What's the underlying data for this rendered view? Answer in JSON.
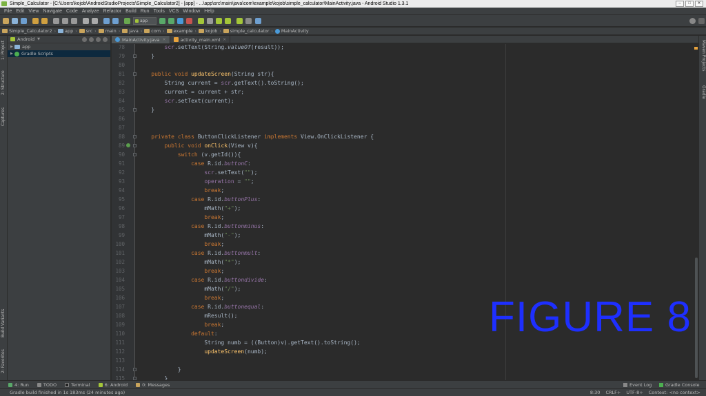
{
  "window": {
    "title": "Simple_Calculator - [C:\\Users\\kojob\\AndroidStudioProjects\\Simple_Calculator2] - [app] - ...\\app\\src\\main\\java\\com\\example\\kojob\\simple_calculator\\MainActivity.java - Android Studio 1.3.1"
  },
  "menu": [
    "File",
    "Edit",
    "View",
    "Navigate",
    "Code",
    "Analyze",
    "Refactor",
    "Build",
    "Run",
    "Tools",
    "VCS",
    "Window",
    "Help"
  ],
  "toolbar": {
    "run_config": "app"
  },
  "breadcrumbs": [
    "Simple_Calculator2",
    "app",
    "src",
    "main",
    "java",
    "com",
    "example",
    "kojob",
    "simple_calculator",
    "MainActivity"
  ],
  "project_panel": {
    "view_mode": "Android",
    "items": [
      {
        "label": "app",
        "selected": false
      },
      {
        "label": "Gradle Scripts",
        "selected": true
      }
    ]
  },
  "left_tool_tabs": [
    "1: Project",
    "2: Structure",
    "Captures",
    "Build Variants",
    "2: Favorites"
  ],
  "right_tool_tabs": [
    "Maven Projects",
    "Gradle"
  ],
  "editor_tabs": [
    {
      "label": "MainActivity.java",
      "active": true,
      "type": "java"
    },
    {
      "label": "activity_main.xml",
      "active": false,
      "type": "xml"
    }
  ],
  "code_lines": [
    {
      "n": "78",
      "code": "        scr.setText(String.valueOf(result));"
    },
    {
      "n": "79",
      "code": "    }"
    },
    {
      "n": "80",
      "code": ""
    },
    {
      "n": "81",
      "code": "    public void updateScreen(String str){"
    },
    {
      "n": "82",
      "code": "        String current = scr.getText().toString();"
    },
    {
      "n": "83",
      "code": "        current = current + str;"
    },
    {
      "n": "84",
      "code": "        scr.setText(current);"
    },
    {
      "n": "85",
      "code": "    }"
    },
    {
      "n": "86",
      "code": ""
    },
    {
      "n": "87",
      "code": ""
    },
    {
      "n": "88",
      "code": "    private class ButtonClickListener implements View.OnClickListener {"
    },
    {
      "n": "89",
      "code": "        public void onClick(View v){"
    },
    {
      "n": "90",
      "code": "            switch (v.getId()){"
    },
    {
      "n": "91",
      "code": "                case R.id.buttonC:"
    },
    {
      "n": "92",
      "code": "                    scr.setText(\"\");"
    },
    {
      "n": "93",
      "code": "                    operation = \"\";"
    },
    {
      "n": "94",
      "code": "                    break;"
    },
    {
      "n": "95",
      "code": "                case R.id.buttonPlus:"
    },
    {
      "n": "96",
      "code": "                    mMath(\"+\");"
    },
    {
      "n": "97",
      "code": "                    break;"
    },
    {
      "n": "98",
      "code": "                case R.id.buttonminus:"
    },
    {
      "n": "99",
      "code": "                    mMath(\"-\");"
    },
    {
      "n": "100",
      "code": "                    break;"
    },
    {
      "n": "101",
      "code": "                case R.id.buttonmult:"
    },
    {
      "n": "102",
      "code": "                    mMath(\"*\");"
    },
    {
      "n": "103",
      "code": "                    break;"
    },
    {
      "n": "104",
      "code": "                case R.id.buttondivide:"
    },
    {
      "n": "105",
      "code": "                    mMath(\"/\");"
    },
    {
      "n": "106",
      "code": "                    break;"
    },
    {
      "n": "107",
      "code": "                case R.id.buttonequal:"
    },
    {
      "n": "108",
      "code": "                    mResult();"
    },
    {
      "n": "109",
      "code": "                    break;"
    },
    {
      "n": "110",
      "code": "                default:"
    },
    {
      "n": "111",
      "code": "                    String numb = ((Button)v).getText().toString();"
    },
    {
      "n": "112",
      "code": "                    updateScreen(numb);"
    },
    {
      "n": "113",
      "code": ""
    },
    {
      "n": "114",
      "code": "            }"
    },
    {
      "n": "115",
      "code": "        }"
    }
  ],
  "overlay_label": "FIGURE 8",
  "tool_windows": {
    "left": [
      "4: Run",
      "TODO",
      "Terminal",
      "6: Android",
      "0: Messages"
    ],
    "right": [
      "Event Log",
      "Gradle Console"
    ]
  },
  "status": {
    "message": "Gradle build finished in 1s 183ms (24 minutes ago)",
    "position": "8:30",
    "line_sep": "CRLF÷",
    "encoding": "UTF-8÷",
    "context": "Context: <no context>"
  },
  "colors": {
    "editor_bg": "#2b2b2b",
    "panel_bg": "#3c3f41",
    "keyword": "#cc7832",
    "function": "#ffc66d",
    "string": "#6a8759",
    "field": "#9876aa",
    "overlay": "#1e2fff"
  }
}
